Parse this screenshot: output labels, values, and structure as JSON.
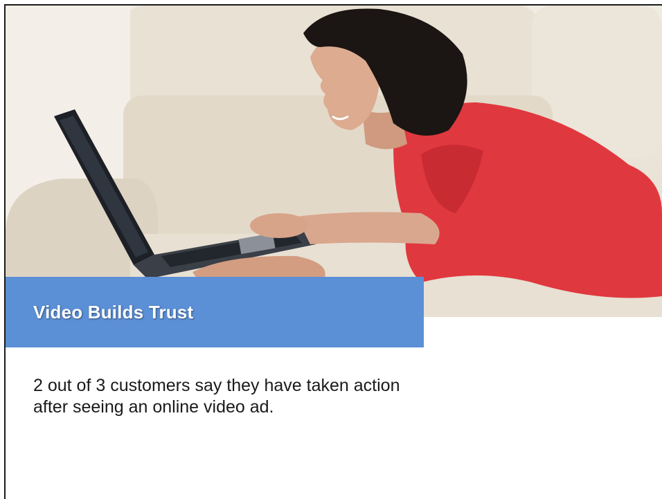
{
  "slide": {
    "title": "Video Builds Trust",
    "body_lines": [
      "2 out of 3 customers say they have taken action",
      "after seeing an online video ad."
    ]
  },
  "photo": {
    "subject": "woman-using-laptop-on-sofa"
  },
  "colors": {
    "title_band": "#5b8fd6",
    "title_text": "#ffffff",
    "body_text": "#1a1a1a",
    "background": "#ffffff"
  }
}
